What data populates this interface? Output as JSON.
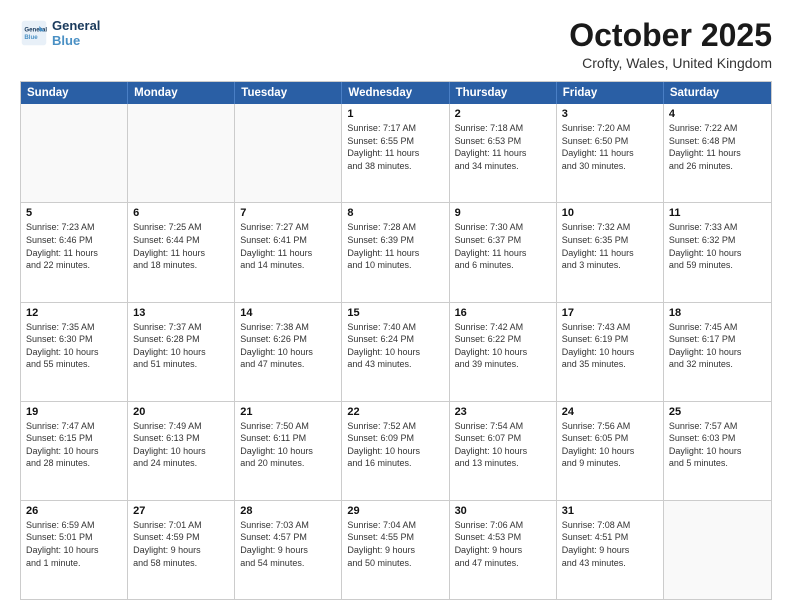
{
  "header": {
    "logo_line1": "General",
    "logo_line2": "Blue",
    "month_title": "October 2025",
    "location": "Crofty, Wales, United Kingdom"
  },
  "days_of_week": [
    "Sunday",
    "Monday",
    "Tuesday",
    "Wednesday",
    "Thursday",
    "Friday",
    "Saturday"
  ],
  "weeks": [
    [
      {
        "date": "",
        "info": ""
      },
      {
        "date": "",
        "info": ""
      },
      {
        "date": "",
        "info": ""
      },
      {
        "date": "1",
        "info": "Sunrise: 7:17 AM\nSunset: 6:55 PM\nDaylight: 11 hours\nand 38 minutes."
      },
      {
        "date": "2",
        "info": "Sunrise: 7:18 AM\nSunset: 6:53 PM\nDaylight: 11 hours\nand 34 minutes."
      },
      {
        "date": "3",
        "info": "Sunrise: 7:20 AM\nSunset: 6:50 PM\nDaylight: 11 hours\nand 30 minutes."
      },
      {
        "date": "4",
        "info": "Sunrise: 7:22 AM\nSunset: 6:48 PM\nDaylight: 11 hours\nand 26 minutes."
      }
    ],
    [
      {
        "date": "5",
        "info": "Sunrise: 7:23 AM\nSunset: 6:46 PM\nDaylight: 11 hours\nand 22 minutes."
      },
      {
        "date": "6",
        "info": "Sunrise: 7:25 AM\nSunset: 6:44 PM\nDaylight: 11 hours\nand 18 minutes."
      },
      {
        "date": "7",
        "info": "Sunrise: 7:27 AM\nSunset: 6:41 PM\nDaylight: 11 hours\nand 14 minutes."
      },
      {
        "date": "8",
        "info": "Sunrise: 7:28 AM\nSunset: 6:39 PM\nDaylight: 11 hours\nand 10 minutes."
      },
      {
        "date": "9",
        "info": "Sunrise: 7:30 AM\nSunset: 6:37 PM\nDaylight: 11 hours\nand 6 minutes."
      },
      {
        "date": "10",
        "info": "Sunrise: 7:32 AM\nSunset: 6:35 PM\nDaylight: 11 hours\nand 3 minutes."
      },
      {
        "date": "11",
        "info": "Sunrise: 7:33 AM\nSunset: 6:32 PM\nDaylight: 10 hours\nand 59 minutes."
      }
    ],
    [
      {
        "date": "12",
        "info": "Sunrise: 7:35 AM\nSunset: 6:30 PM\nDaylight: 10 hours\nand 55 minutes."
      },
      {
        "date": "13",
        "info": "Sunrise: 7:37 AM\nSunset: 6:28 PM\nDaylight: 10 hours\nand 51 minutes."
      },
      {
        "date": "14",
        "info": "Sunrise: 7:38 AM\nSunset: 6:26 PM\nDaylight: 10 hours\nand 47 minutes."
      },
      {
        "date": "15",
        "info": "Sunrise: 7:40 AM\nSunset: 6:24 PM\nDaylight: 10 hours\nand 43 minutes."
      },
      {
        "date": "16",
        "info": "Sunrise: 7:42 AM\nSunset: 6:22 PM\nDaylight: 10 hours\nand 39 minutes."
      },
      {
        "date": "17",
        "info": "Sunrise: 7:43 AM\nSunset: 6:19 PM\nDaylight: 10 hours\nand 35 minutes."
      },
      {
        "date": "18",
        "info": "Sunrise: 7:45 AM\nSunset: 6:17 PM\nDaylight: 10 hours\nand 32 minutes."
      }
    ],
    [
      {
        "date": "19",
        "info": "Sunrise: 7:47 AM\nSunset: 6:15 PM\nDaylight: 10 hours\nand 28 minutes."
      },
      {
        "date": "20",
        "info": "Sunrise: 7:49 AM\nSunset: 6:13 PM\nDaylight: 10 hours\nand 24 minutes."
      },
      {
        "date": "21",
        "info": "Sunrise: 7:50 AM\nSunset: 6:11 PM\nDaylight: 10 hours\nand 20 minutes."
      },
      {
        "date": "22",
        "info": "Sunrise: 7:52 AM\nSunset: 6:09 PM\nDaylight: 10 hours\nand 16 minutes."
      },
      {
        "date": "23",
        "info": "Sunrise: 7:54 AM\nSunset: 6:07 PM\nDaylight: 10 hours\nand 13 minutes."
      },
      {
        "date": "24",
        "info": "Sunrise: 7:56 AM\nSunset: 6:05 PM\nDaylight: 10 hours\nand 9 minutes."
      },
      {
        "date": "25",
        "info": "Sunrise: 7:57 AM\nSunset: 6:03 PM\nDaylight: 10 hours\nand 5 minutes."
      }
    ],
    [
      {
        "date": "26",
        "info": "Sunrise: 6:59 AM\nSunset: 5:01 PM\nDaylight: 10 hours\nand 1 minute."
      },
      {
        "date": "27",
        "info": "Sunrise: 7:01 AM\nSunset: 4:59 PM\nDaylight: 9 hours\nand 58 minutes."
      },
      {
        "date": "28",
        "info": "Sunrise: 7:03 AM\nSunset: 4:57 PM\nDaylight: 9 hours\nand 54 minutes."
      },
      {
        "date": "29",
        "info": "Sunrise: 7:04 AM\nSunset: 4:55 PM\nDaylight: 9 hours\nand 50 minutes."
      },
      {
        "date": "30",
        "info": "Sunrise: 7:06 AM\nSunset: 4:53 PM\nDaylight: 9 hours\nand 47 minutes."
      },
      {
        "date": "31",
        "info": "Sunrise: 7:08 AM\nSunset: 4:51 PM\nDaylight: 9 hours\nand 43 minutes."
      },
      {
        "date": "",
        "info": ""
      }
    ]
  ]
}
